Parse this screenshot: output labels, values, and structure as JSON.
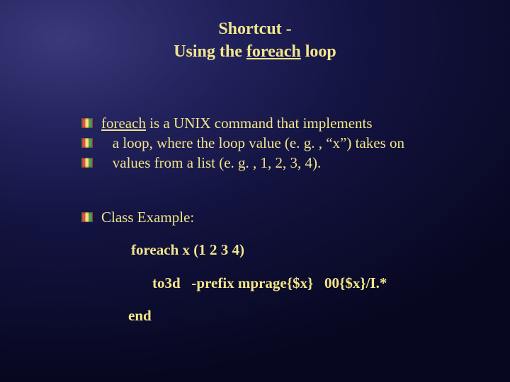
{
  "title": {
    "line1": "Shortcut -",
    "line2_pre": "Using the ",
    "line2_kw": "foreach",
    "line2_post": " loop"
  },
  "bullets": {
    "b1_kw": "foreach",
    "b1_post": " is a UNIX command that implements",
    "b2": "   a loop, where the loop value (e. g. , “x”) takes on",
    "b3": "   values from a list (e. g. , 1, 2, 3, 4)."
  },
  "example": {
    "label": "Class Example:",
    "line1": "foreach x (1 2 3 4)",
    "line2": "to3d   -prefix mprage{$x}   00{$x}/I.*",
    "line3": "end"
  }
}
